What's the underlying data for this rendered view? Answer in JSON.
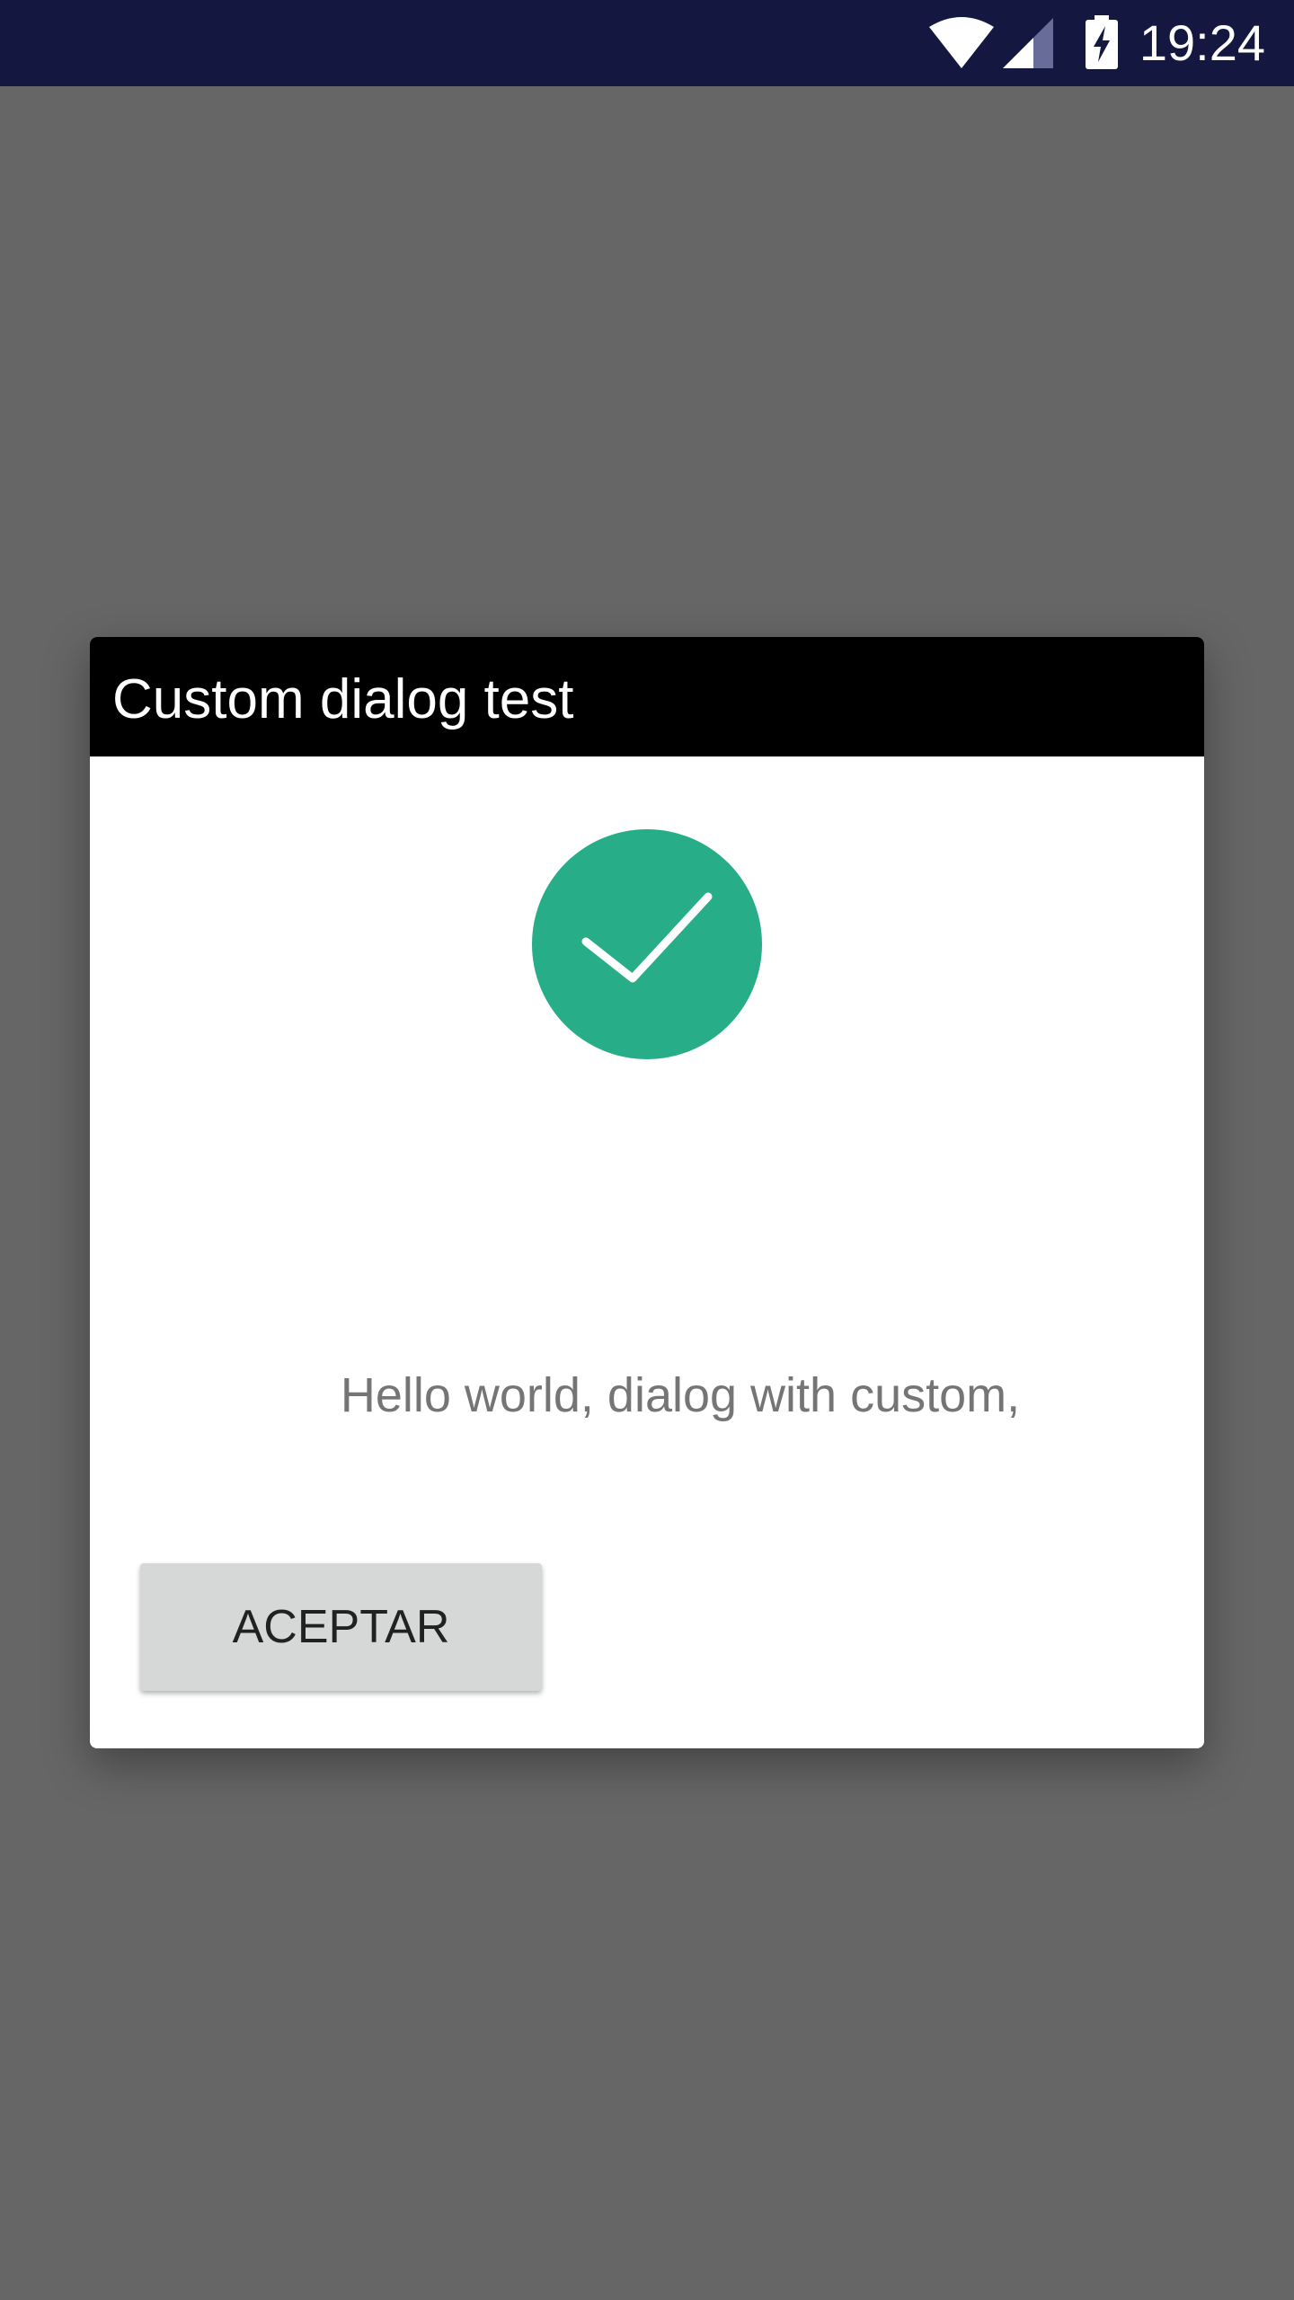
{
  "status_bar": {
    "time": "19:24",
    "icons": [
      "wifi-icon",
      "cellular-signal-icon",
      "battery-charging-icon"
    ],
    "background_color": "#141841"
  },
  "screen": {
    "scrim_color": "#666666"
  },
  "dialog": {
    "title": "Custom dialog test",
    "title_bar_color": "#000000",
    "icon": "check-circle-icon",
    "icon_color": "#27ae89",
    "message": "Hello world, dialog with custom,",
    "accept_button_label": "ACEPTAR"
  }
}
